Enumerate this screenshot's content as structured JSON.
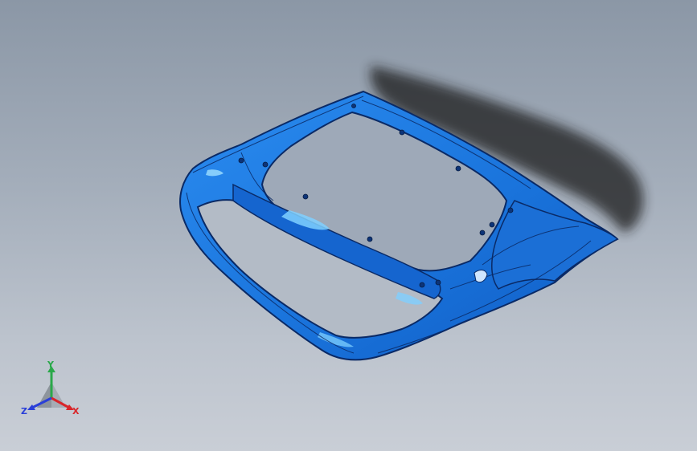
{
  "viewport": {
    "background_top": "#8b97a6",
    "background_bottom": "#c9ced6"
  },
  "model": {
    "name": "",
    "body_color": "#1f7ee0",
    "edge_color": "#0a2a66",
    "highlight_color": "#7fd0ff",
    "shadow_color": "#1e1e1e"
  },
  "triad": {
    "x_label": "X",
    "y_label": "Y",
    "z_label": "Z",
    "x_color": "#d8262a",
    "y_color": "#2aa84a",
    "z_color": "#2a3fd8"
  }
}
